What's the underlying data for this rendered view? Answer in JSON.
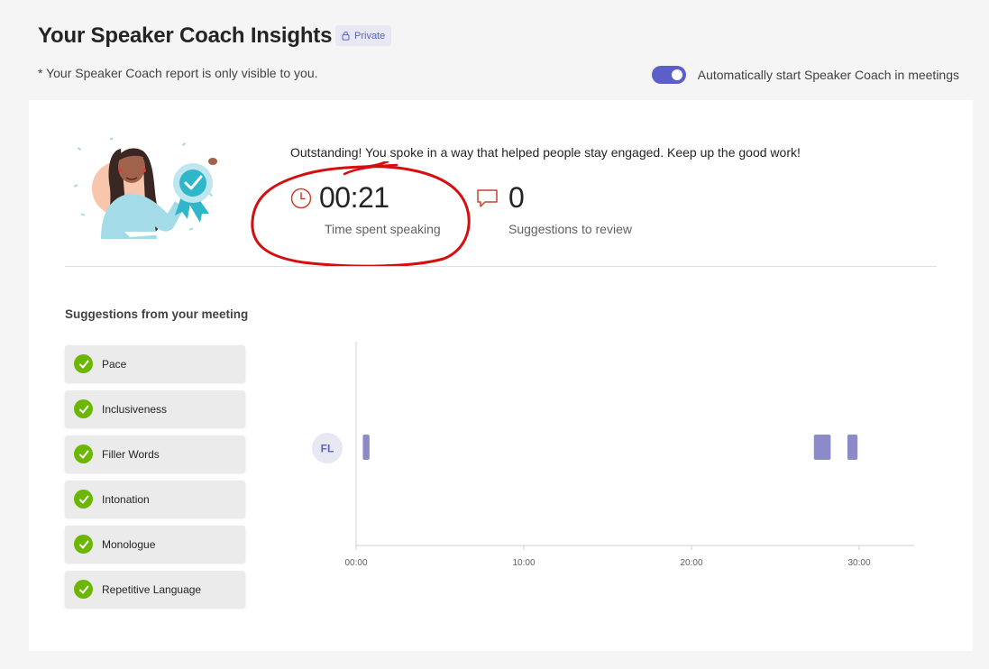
{
  "header": {
    "title": "Your Speaker Coach Insights",
    "private_badge": "Private",
    "visibility_note": "* Your Speaker Coach report is only visible to you.",
    "auto_start": {
      "label": "Automatically start Speaker Coach in meetings",
      "enabled": true
    }
  },
  "summary": {
    "message": "Outstanding! You spoke in a way that helped people stay engaged. Keep up the good work!",
    "time_spent": {
      "value": "00:21",
      "label": "Time spent speaking",
      "icon": "clock-icon"
    },
    "suggestions": {
      "value": "0",
      "label": "Suggestions to review",
      "icon": "chat-bubble-icon"
    }
  },
  "suggestions": {
    "title": "Suggestions from your meeting",
    "items": [
      {
        "label": "Pace",
        "status": "passed"
      },
      {
        "label": "Inclusiveness",
        "status": "passed"
      },
      {
        "label": "Filler Words",
        "status": "passed"
      },
      {
        "label": "Intonation",
        "status": "passed"
      },
      {
        "label": "Monologue",
        "status": "passed"
      },
      {
        "label": "Repetitive Language",
        "status": "passed"
      }
    ]
  },
  "timeline": {
    "speaker_initials": "FL",
    "x_ticks": [
      "00:00",
      "10:00",
      "20:00",
      "30:00"
    ],
    "segments_minutes": [
      [
        0.4,
        0.8
      ],
      [
        27.3,
        28.3
      ],
      [
        29.3,
        29.9
      ]
    ]
  },
  "colors": {
    "accent": "#5b5fc7",
    "segment": "#8b8cc7",
    "check": "#6bb700",
    "annotation": "#d40f0f",
    "icon": "#c4452f"
  }
}
